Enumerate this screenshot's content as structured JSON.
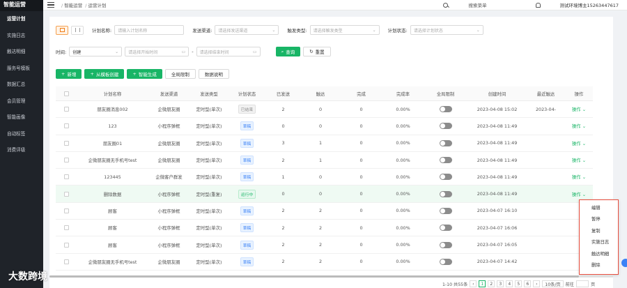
{
  "sidebar": {
    "title": "智能运营",
    "items": [
      {
        "label": "运营计划",
        "active": true
      },
      {
        "label": "实施日志",
        "active": false
      },
      {
        "label": "触达明细",
        "active": false
      },
      {
        "label": "服务号模板",
        "active": false
      },
      {
        "label": "数据汇总",
        "active": false
      },
      {
        "label": "会员管理",
        "active": false
      },
      {
        "label": "智能画像",
        "active": false
      },
      {
        "label": "自动标签",
        "active": false
      },
      {
        "label": "消费评级",
        "active": false
      }
    ]
  },
  "header": {
    "breadcrumb": [
      "智能运营",
      "运营计划"
    ],
    "search_label": "搜索菜单",
    "user": "测试环境博主15263447617"
  },
  "filters": {
    "plan_name_label": "计划名称:",
    "plan_name_placeholder": "请输入计划名称",
    "channel_label": "发送渠道:",
    "channel_placeholder": "请选择发送渠道",
    "trigger_label": "触发类型:",
    "trigger_placeholder": "请选择触发类型",
    "status_label": "计划状态:",
    "status_placeholder": "请选择计划状态",
    "time_label": "时间:",
    "time_type": "创建",
    "start_placeholder": "请选择开始时间",
    "end_placeholder": "请选择结束时间",
    "range_sep": "-",
    "query_label": "查询",
    "reset_label": "重置"
  },
  "actions": {
    "new": "新增",
    "from_template": "从模板创建",
    "smart_generate": "智能生成",
    "global_limit": "全局限制",
    "data_desc": "数据说明"
  },
  "table": {
    "headers": [
      "计划名称",
      "发送渠道",
      "发送类型",
      "计划状态",
      "已发送",
      "触达",
      "完成",
      "完成率",
      "全局限制",
      "创建时间",
      "最近触达",
      "操作"
    ],
    "rows": [
      {
        "name": "朋友圈消息002",
        "channel": "企微朋友圈",
        "type": "定时型(单次)",
        "status": "已结束",
        "status_kind": "grey",
        "sent": "2",
        "reach": "0",
        "done": "0",
        "rate": "0.00%",
        "created": "2023-04-08 15:02",
        "recent": "2023-04-",
        "op": "操作",
        "hl": false
      },
      {
        "name": "123",
        "channel": "小程序弹框",
        "type": "定时型(单次)",
        "status": "草稿",
        "status_kind": "blue",
        "sent": "0",
        "reach": "0",
        "done": "0",
        "rate": "0.00%",
        "created": "2023-04-08 11:49",
        "recent": "",
        "op": "操作",
        "hl": false
      },
      {
        "name": "朋友圈01",
        "channel": "企微朋友圈",
        "type": "定时型(单次)",
        "status": "草稿",
        "status_kind": "blue",
        "sent": "3",
        "reach": "1",
        "done": "0",
        "rate": "0.00%",
        "created": "2023-04-08 11:49",
        "recent": "",
        "op": "操作",
        "hl": false
      },
      {
        "name": "企微朋友圈无手机号test",
        "channel": "企微朋友圈",
        "type": "定时型(单次)",
        "status": "草稿",
        "status_kind": "blue",
        "sent": "2",
        "reach": "1",
        "done": "0",
        "rate": "0.00%",
        "created": "2023-04-08 11:49",
        "recent": "",
        "op": "操作",
        "hl": false
      },
      {
        "name": "123445",
        "channel": "企微客户群发",
        "type": "定时型(单次)",
        "status": "草稿",
        "status_kind": "blue",
        "sent": "1",
        "reach": "0",
        "done": "0",
        "rate": "0.00%",
        "created": "2023-04-08 11:49",
        "recent": "",
        "op": "操作",
        "hl": false
      },
      {
        "name": "删除数据",
        "channel": "小程序弹框",
        "type": "定时型(重复)",
        "status": "运行中",
        "status_kind": "green",
        "sent": "0",
        "reach": "0",
        "done": "0",
        "rate": "0.00%",
        "created": "2023-04-08 11:49",
        "recent": "",
        "op": "操作",
        "hl": true
      },
      {
        "name": "顾客",
        "channel": "小程序弹框",
        "type": "定时型(单次)",
        "status": "草稿",
        "status_kind": "blue",
        "sent": "2",
        "reach": "2",
        "done": "0",
        "rate": "0.00%",
        "created": "2023-04-07 16:10",
        "recent": "",
        "op": "",
        "hl": false
      },
      {
        "name": "顾客",
        "channel": "小程序弹框",
        "type": "定时型(单次)",
        "status": "草稿",
        "status_kind": "blue",
        "sent": "2",
        "reach": "2",
        "done": "0",
        "rate": "0.00%",
        "created": "2023-04-07 16:06",
        "recent": "",
        "op": "",
        "hl": false
      },
      {
        "name": "顾客",
        "channel": "小程序弹框",
        "type": "定时型(单次)",
        "status": "草稿",
        "status_kind": "blue",
        "sent": "2",
        "reach": "2",
        "done": "0",
        "rate": "0.00%",
        "created": "2023-04-07 16:05",
        "recent": "",
        "op": "",
        "hl": false
      },
      {
        "name": "企微朋友圈无手机号test",
        "channel": "企微朋友圈",
        "type": "定时型(单次)",
        "status": "草稿",
        "status_kind": "blue",
        "sent": "2",
        "reach": "2",
        "done": "0",
        "rate": "0.00%",
        "created": "2023-04-07 14:42",
        "recent": "",
        "op": "",
        "hl": false
      }
    ]
  },
  "dropdown": {
    "items": [
      "编辑",
      "暂停",
      "复制",
      "实施日志",
      "触达明细",
      "删除"
    ]
  },
  "pagination": {
    "range": "1-10 共55条",
    "pages": [
      "1",
      "2",
      "3",
      "4",
      "5",
      "6"
    ],
    "size": "10条/页",
    "jump_label": "前往",
    "page_suffix": "页"
  },
  "watermark": "大数跨境",
  "colors": {
    "accent": "#18b566",
    "sidebar_bg": "#1f2329",
    "highlight_border": "#e74c3c"
  }
}
